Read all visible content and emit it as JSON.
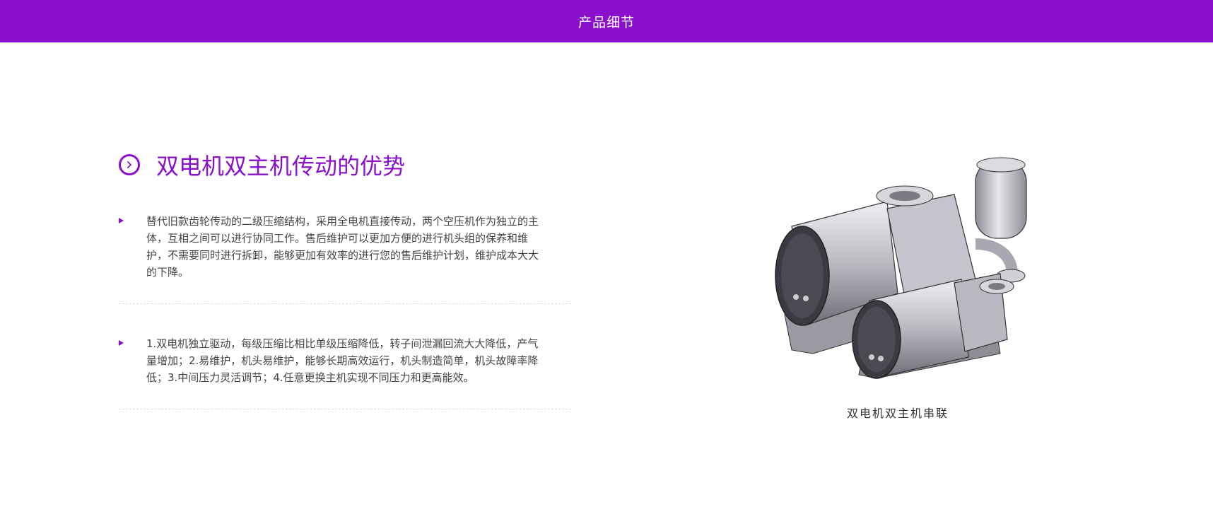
{
  "header": {
    "title": "产品细节",
    "background": "#8a10cc"
  },
  "section": {
    "icon": "chevron-right-circle-icon",
    "title": "双电机双主机传动的优势",
    "accent": "#8a10cc",
    "items": [
      {
        "text": "替代旧款齿轮传动的二级压缩结构，采用全电机直接传动，两个空压机作为独立的主体，互相之间可以进行协同工作。售后维护可以更加方便的进行机头组的保养和维护，不需要同时进行拆卸，能够更加有效率的进行您的售后维护计划，维护成本大大的下降。"
      },
      {
        "text": "1.双电机独立驱动，每级压缩比相比单级压缩降低，转子间泄漏回流大大降低，产气量增加；2.易维护，机头易维护，能够长期高效运行，机头制造简单，机头故障率降低；3.中间压力灵活调节；4.任意更换主机实现不同压力和更高能效。"
      }
    ]
  },
  "figure": {
    "caption": "双电机双主机串联"
  }
}
